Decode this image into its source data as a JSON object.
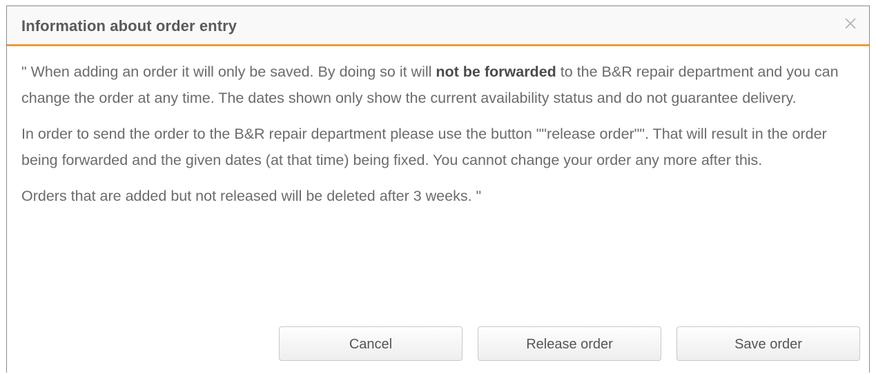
{
  "dialog": {
    "title": "Information about order entry",
    "close_icon": "close-icon",
    "paragraphs": {
      "p1_before": "\" When adding an order it will only be saved. By doing so it will ",
      "p1_bold": "not be forwarded",
      "p1_after": " to the B&R repair department and you can change the order at any time. The dates shown only show the current availability status and do not guarantee delivery.",
      "p2": "In order to send the order to the B&R repair department please use the button \"\"release order\"\". That will result in the order being forwarded and the given dates (at that time) being fixed. You cannot change your order any more after this.",
      "p3": "Orders that are added but not released will be deleted after 3 weeks. \""
    },
    "buttons": {
      "cancel": "Cancel",
      "release": "Release order",
      "save": "Save order"
    }
  },
  "colors": {
    "accent": "#f39a33",
    "title_text": "#5a5a5a",
    "body_text": "#6b6b6b"
  }
}
